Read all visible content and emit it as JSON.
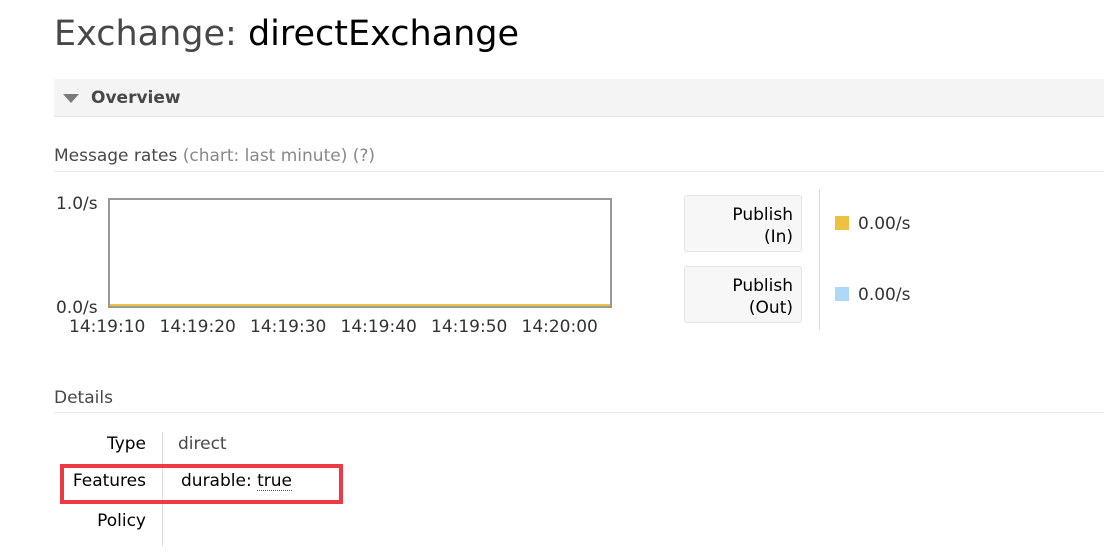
{
  "page": {
    "title_prefix": "Exchange:",
    "title_name": "directExchange"
  },
  "overview": {
    "label": "Overview"
  },
  "message_rates": {
    "heading": "Message rates",
    "chart_note": "(chart: last minute)",
    "help": "(?)"
  },
  "chart_data": {
    "type": "area",
    "x": [
      "14:19:10",
      "14:19:20",
      "14:19:30",
      "14:19:40",
      "14:19:50",
      "14:20:00"
    ],
    "ylim": [
      0,
      1.0
    ],
    "y_ticks": [
      "1.0/s",
      "0.0/s"
    ],
    "series": [
      {
        "name": "Publish (In)",
        "values": [
          0,
          0,
          0,
          0,
          0,
          0
        ],
        "color": "#edc240"
      },
      {
        "name": "Publish (Out)",
        "values": [
          0,
          0,
          0,
          0,
          0,
          0
        ],
        "color": "#afd8f8"
      }
    ],
    "border_color": "#999999",
    "grid": false
  },
  "legend": [
    {
      "line1": "Publish",
      "line2": "(In)",
      "value": "0.00/s",
      "color": "#edc240"
    },
    {
      "line1": "Publish",
      "line2": "(Out)",
      "value": "0.00/s",
      "color": "#afd8f8"
    }
  ],
  "details": {
    "heading": "Details",
    "rows": {
      "type": {
        "label": "Type",
        "value": "direct"
      },
      "features": {
        "label": "Features",
        "key": "durable:",
        "value": "true"
      },
      "policy": {
        "label": "Policy",
        "value": ""
      }
    },
    "highlight_color": "#ee3a43"
  }
}
